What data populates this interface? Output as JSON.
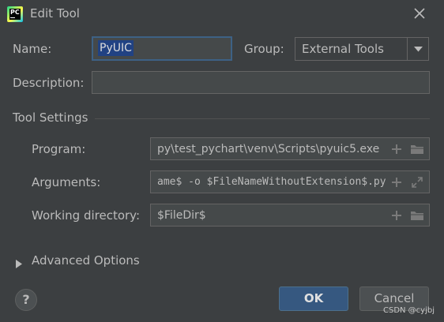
{
  "window": {
    "title": "Edit Tool",
    "app_icon_text": "PC"
  },
  "form": {
    "name_label": "Name:",
    "name_value": "PyUIC",
    "group_label": "Group:",
    "group_value": "External Tools",
    "description_label": "Description:",
    "description_value": ""
  },
  "tool_settings": {
    "section_title": "Tool Settings",
    "program_label": "Program:",
    "program_value": "py\\test_pychart\\venv\\Scripts\\pyuic5.exe",
    "arguments_label": "Arguments:",
    "arguments_value": "ame$ -o $FileNameWithoutExtension$.py",
    "working_dir_label": "Working directory:",
    "working_dir_value": "$FileDir$"
  },
  "advanced": {
    "label": "Advanced Options"
  },
  "buttons": {
    "help": "?",
    "ok": "OK",
    "cancel": "Cancel"
  },
  "watermark": "CSDN @cyjbj",
  "icons": {
    "app": "pycharm-icon",
    "close": "close-icon",
    "dropdown": "chevron-down-icon",
    "add": "plus-icon",
    "folder": "folder-icon",
    "expand": "expand-icon",
    "disclosure": "triangle-right-icon"
  },
  "colors": {
    "background": "#3c3f41",
    "field_bg": "#45494a",
    "selection": "#214283",
    "ok_button": "#365880",
    "text": "#bbbbbb"
  }
}
